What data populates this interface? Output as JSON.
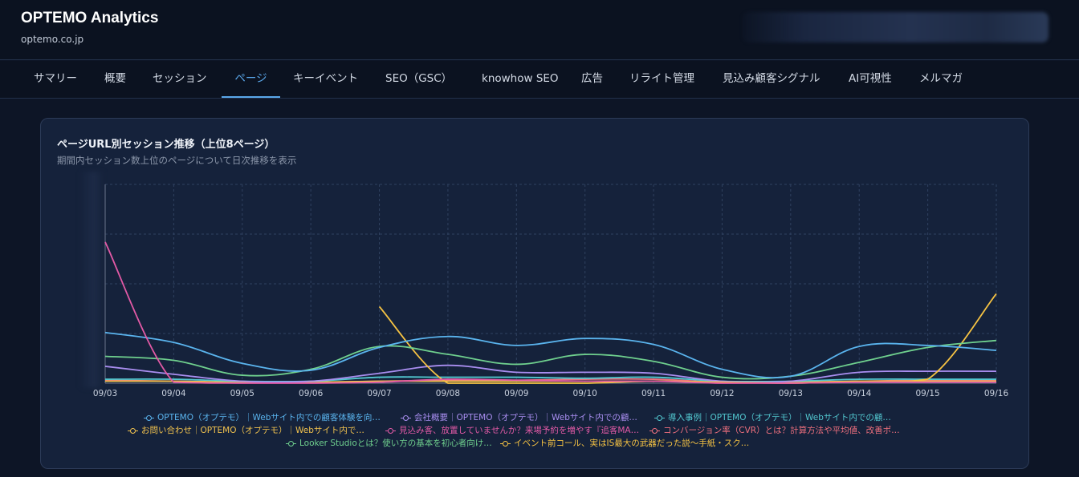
{
  "header": {
    "app_title": "OPTEMO Analytics",
    "domain": "optemo.co.jp"
  },
  "tabs": [
    {
      "label": "サマリー"
    },
    {
      "label": "概要"
    },
    {
      "label": "セッション"
    },
    {
      "label": "ページ",
      "active": true
    },
    {
      "label": "キーイベント"
    },
    {
      "label": "SEO（GSC）"
    },
    {
      "label": "knowhow SEO"
    },
    {
      "label": "広告"
    },
    {
      "label": "リライト管理"
    },
    {
      "label": "見込み顧客シグナル"
    },
    {
      "label": "AI可視性"
    },
    {
      "label": "メルマガ"
    }
  ],
  "card": {
    "title": "ページURL別セッション推移（上位8ページ）",
    "subtitle": "期間内セッション数上位のページについて日次推移を表示"
  },
  "chart_data": {
    "type": "line",
    "x": [
      "09/03",
      "09/04",
      "09/05",
      "09/06",
      "09/07",
      "09/08",
      "09/09",
      "09/10",
      "09/11",
      "09/12",
      "09/13",
      "09/14",
      "09/15",
      "09/16"
    ],
    "y_range": [
      0,
      100
    ],
    "grid": true,
    "y_tick_labels_visible": false,
    "legend_position": "bottom",
    "series": [
      {
        "name": "OPTEMO（オプテモ）｜Webサイト内での顧客体験を向…",
        "color": "#5ab4ee",
        "values": [
          25.5,
          20.5,
          10,
          6.5,
          18,
          23.5,
          19,
          22.5,
          19.5,
          7,
          3.5,
          18.5,
          19,
          16.5
        ]
      },
      {
        "name": "会社概要｜OPTEMO（オプテモ）｜Webサイト内での顧…",
        "color": "#a98ef0",
        "values": [
          8.5,
          4.5,
          1,
          1,
          5,
          9,
          5.5,
          5.5,
          5,
          1,
          1,
          5.5,
          6,
          6
        ]
      },
      {
        "name": "導入事例｜OPTEMO（オプテモ）｜Webサイト内での顧…",
        "color": "#52c7cf",
        "values": [
          2,
          2,
          1,
          1,
          3,
          3,
          3,
          2.5,
          3,
          1,
          1,
          2,
          2,
          2
        ]
      },
      {
        "name": "お問い合わせ｜OPTEMO（オプテモ）｜Webサイト内で…",
        "color": "#f1c24e",
        "values": [
          1,
          1,
          0.5,
          0.5,
          1,
          1,
          1,
          1,
          1,
          0.5,
          0.5,
          1,
          1,
          1
        ]
      },
      {
        "name": "見込み客、放置していませんか？来場予約を増やす『追客MA…",
        "color": "#e25aa6",
        "values": [
          71,
          0.5,
          0,
          0,
          0.5,
          2,
          1.5,
          1,
          1,
          0,
          0,
          0.5,
          0.5,
          0.5
        ]
      },
      {
        "name": "コンバージョン率（CVR）とは？計算方法や平均値、改善ポ…",
        "color": "#f0707e",
        "values": [
          1.5,
          1,
          0.5,
          0.5,
          1,
          1.5,
          1.5,
          2,
          2,
          0.5,
          0.5,
          1,
          1.5,
          1.5
        ]
      },
      {
        "name": "Looker Studioとは？使い方の基本を初心者向け…",
        "color": "#6fd08e",
        "values": [
          13.5,
          11.5,
          4,
          7,
          18.5,
          14.5,
          9.5,
          14.5,
          11,
          3,
          3.5,
          10.5,
          18,
          21.5
        ]
      },
      {
        "name": "イベント前コール、実はIS最大の武器だった説〜手紙・スク…",
        "color": "#f6c343",
        "values": [
          null,
          null,
          null,
          null,
          38.5,
          0,
          0,
          0,
          1,
          0.5,
          0,
          1,
          2,
          45
        ]
      }
    ]
  }
}
